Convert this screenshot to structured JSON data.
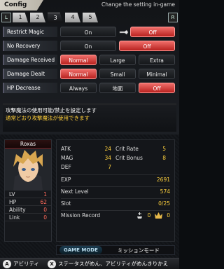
{
  "header": {
    "title": "Config",
    "note": "Change the setting in-game",
    "left_shoulder": "L",
    "right_shoulder": "R",
    "tabs": [
      "1",
      "2",
      "3",
      "4",
      "5"
    ],
    "active_tab": "3"
  },
  "settings": [
    {
      "label": "Restrict Magic",
      "options": [
        "On",
        "Off"
      ],
      "selected": "Off"
    },
    {
      "label": "No Recovery",
      "options": [
        "On",
        "Off"
      ],
      "selected": "Off"
    },
    {
      "label": "Damage Received",
      "options": [
        "Normal",
        "Large",
        "Extra"
      ],
      "selected": "Normal"
    },
    {
      "label": "Damage Dealt",
      "options": [
        "Normal",
        "Small",
        "Minimal"
      ],
      "selected": "Normal"
    },
    {
      "label": "HP Decrease",
      "options": [
        "Always",
        "地面",
        "Off"
      ],
      "selected": "Off"
    }
  ],
  "description": {
    "line1": "攻撃魔法の使用可能/禁止を設定します",
    "line2": "通常どおり攻撃魔法が使用できます"
  },
  "character": {
    "name": "Roxas",
    "stats": [
      {
        "label": "LV",
        "value": "1"
      },
      {
        "label": "HP",
        "value": "62"
      },
      {
        "label": "Ability",
        "value": "0"
      },
      {
        "label": "Link",
        "value": "0"
      }
    ]
  },
  "stats": {
    "grid": [
      {
        "label": "ATK",
        "value": "24"
      },
      {
        "label": "Crit Rate",
        "value": "5"
      },
      {
        "label": "MAG",
        "value": "34"
      },
      {
        "label": "Crit Bonus",
        "value": "8"
      },
      {
        "label": "DEF",
        "value": "7"
      }
    ],
    "exp": {
      "label": "EXP",
      "value": "2691"
    },
    "next_level": {
      "label": "Next Level",
      "value": "574"
    },
    "slot": {
      "label": "Slot",
      "value": "0/25"
    },
    "mission_record": {
      "label": "Mission Record",
      "value1": "0",
      "value2": "0"
    }
  },
  "mode": {
    "label": "GAME MODE",
    "value": "ミッションモード"
  },
  "footer": {
    "btn1_glyph": "A",
    "btn1_text": "アビリティ",
    "btn2_glyph": "X",
    "btn2_text": "ステータスがめん、アビリティがめんきりかえ"
  },
  "colors": {
    "selected": "#d9423e",
    "accent_text": "#ffd13d",
    "warn_text": "#ffcf3a"
  }
}
